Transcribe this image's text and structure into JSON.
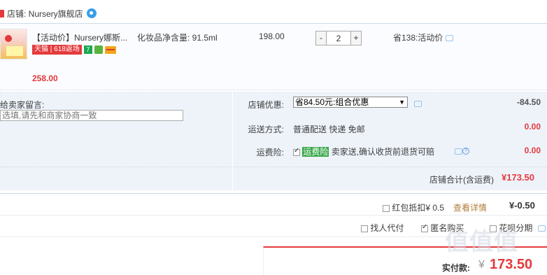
{
  "shop": {
    "name": "店铺: Nursery旗舰店"
  },
  "item": {
    "title": "【活动价】Nursery娜斯...",
    "badge_tmall": "天猫 | 618返场",
    "badge_seven": "7",
    "spec": "化妆品净含量: 91.5ml",
    "unit_price": "198.00",
    "qty_minus": "-",
    "qty_value": "2",
    "qty_plus": "+",
    "promo": "省138:活动价",
    "total": "258.00"
  },
  "message": {
    "label": "给卖家留言:",
    "placeholder": "选填,请先和商家协商一致"
  },
  "shop_discount": {
    "label": "店铺优惠:",
    "selected": "省84.50元:组合优惠",
    "amount": "-84.50"
  },
  "shipping": {
    "label": "运送方式:",
    "value": "普通配送 快递 免邮",
    "amount": "0.00"
  },
  "insurance": {
    "label": "运费险:",
    "highlight": "运费险",
    "value": "卖家送,确认收货前退货可赔",
    "amount": "0.00"
  },
  "shop_total": {
    "label": "店铺合计(含运费)",
    "value": "¥173.50"
  },
  "redpack": {
    "label": "红包抵扣¥ 0.5",
    "link": "查看详情",
    "amount": "¥-0.50"
  },
  "options": {
    "proxy_pay": "找人代付",
    "anonymous": "匿名购买",
    "huabei": "花呗分期"
  },
  "payment": {
    "label": "实付款:",
    "yen": "¥",
    "amount": "173.50"
  },
  "watermark": "值值值",
  "colors": {
    "accent_red": "#e4393c",
    "panel_blue": "#eef3fa",
    "link_brown": "#b07c38",
    "highlight_green": "#38a84a"
  }
}
